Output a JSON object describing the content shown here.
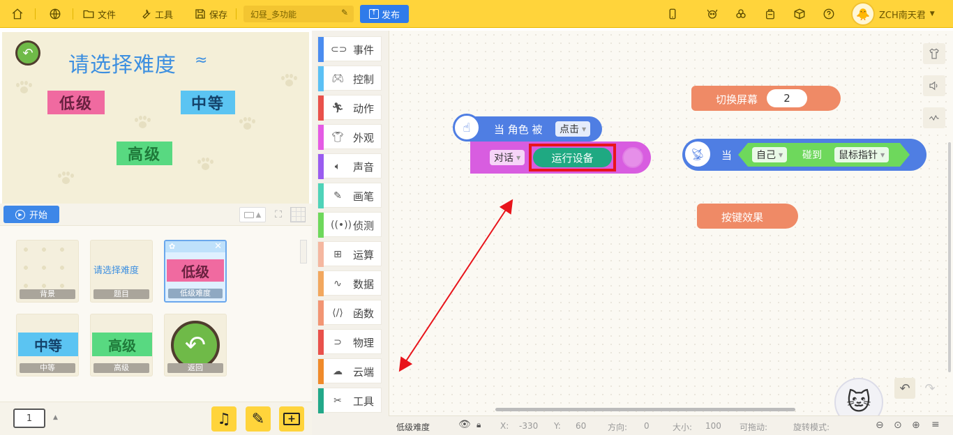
{
  "topbar": {
    "menu_file": "文件",
    "menu_tools": "工具",
    "menu_save": "保存",
    "project_name": "幻昼_多功能",
    "publish_label": "发布",
    "username": "ZCH南天君"
  },
  "stage": {
    "title_art": "请选择难度",
    "level_low": "低级",
    "level_mid": "中等",
    "level_high": "高级",
    "start_label": "开始"
  },
  "sprites": [
    {
      "label": "背景"
    },
    {
      "label": "题目",
      "art": "请选择难度"
    },
    {
      "label": "低级难度",
      "art": "低级"
    },
    {
      "label": "中等",
      "art": "中等"
    },
    {
      "label": "高级",
      "art": "高级"
    },
    {
      "label": "返回"
    }
  ],
  "bottombar": {
    "page_number": "1"
  },
  "categories": [
    {
      "label": "事件",
      "color": "#4a8cf0"
    },
    {
      "label": "控制",
      "color": "#5bc0f5"
    },
    {
      "label": "动作",
      "color": "#e9514b"
    },
    {
      "label": "外观",
      "color": "#e45be4"
    },
    {
      "label": "声音",
      "color": "#9a5cf0"
    },
    {
      "label": "画笔",
      "color": "#4fd3b9"
    },
    {
      "label": "侦测",
      "color": "#6ed85c"
    },
    {
      "label": "运算",
      "color": "#f5b7a0"
    },
    {
      "label": "数据",
      "color": "#f2a75e"
    },
    {
      "label": "函数",
      "color": "#f29573"
    },
    {
      "label": "物理",
      "color": "#e9514b"
    },
    {
      "label": "云端",
      "color": "#f08a2a"
    },
    {
      "label": "工具",
      "color": "#22a889"
    }
  ],
  "blocks": {
    "when_clicked": {
      "prefix": "当 角色 被",
      "option": "点击"
    },
    "say": {
      "label": "对话",
      "value": "运行设备"
    },
    "switch_screen": {
      "label": "切换屏幕",
      "value": "2"
    },
    "when_touch": {
      "label": "当",
      "target": "自己",
      "verb": "碰到",
      "object": "鼠标指针"
    },
    "button_effect": {
      "label": "按键效果"
    }
  },
  "status": {
    "sprite_name": "低级难度",
    "x_label": "X:",
    "x_value": "-330",
    "y_label": "Y:",
    "y_value": "60",
    "dir_label": "方向:",
    "dir_value": "0",
    "size_label": "大小:",
    "size_value": "100",
    "drag_label": "可拖动:",
    "rotate_label": "旋转模式:"
  },
  "colors": {
    "topbar": "#ffd43b",
    "event_block": "#4f7ee3",
    "looks_block": "#d85de0",
    "green_pill": "#1fa982",
    "function_block": "#ef8a66",
    "sense_block": "#6ed85c",
    "highlight": "#e8141b",
    "arrow": "#e8141b"
  }
}
